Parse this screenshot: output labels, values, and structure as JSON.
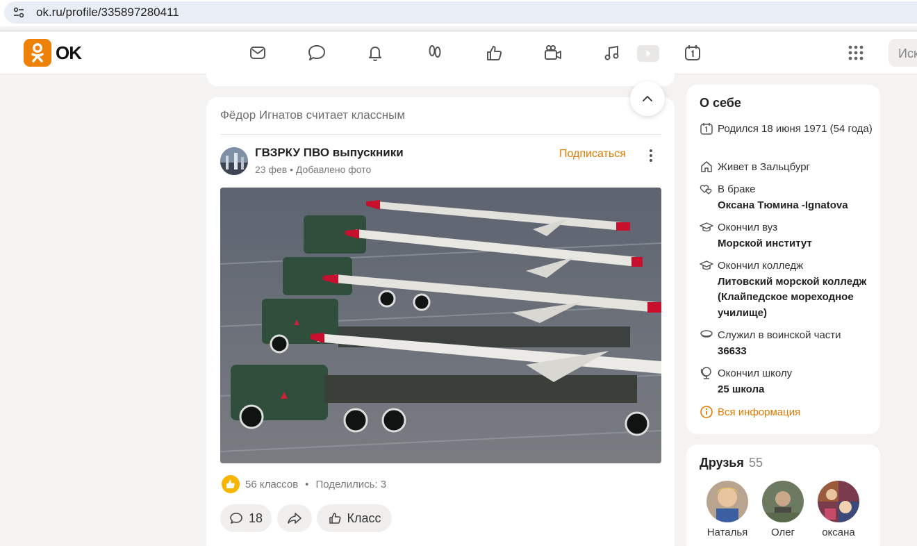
{
  "browser": {
    "url": "ok.ru/profile/335897280411"
  },
  "header": {
    "logo_text": "OK",
    "nav_icons": [
      "mail-icon",
      "chat-icon",
      "bell-icon",
      "guests-icon",
      "likes-icon",
      "video-icon",
      "music-icon",
      "play-icon",
      "calendar-icon"
    ],
    "search_placeholder": "Иск"
  },
  "feed": {
    "liked_by": "Фёдор Игнатов считает классным",
    "post": {
      "group_name": "ГВЗРКУ ПВО выпускники",
      "date": "23 фев",
      "meta_sep": "•",
      "action": "Добавлено фото",
      "subscribe_label": "Подписаться",
      "likes_text": "56 классов",
      "dot": "•",
      "shares_text": "Поделились: 3",
      "comments_count": "18",
      "class_label": "Класс"
    }
  },
  "about": {
    "title": "О себе",
    "rows": [
      {
        "icon": "birthday-icon",
        "text": "Родился 18 июня 1971 (54 года)",
        "bold": ""
      },
      {
        "icon": "home-icon",
        "text": "Живет в Зальцбург",
        "bold": ""
      },
      {
        "icon": "hearts-icon",
        "text": "В браке",
        "bold": "Оксана Тюмина -Ignatova"
      },
      {
        "icon": "graduation-cap-icon",
        "text": "Окончил вуз",
        "bold": "Морской институт"
      },
      {
        "icon": "graduation-cap-icon",
        "text": "Окончил колледж",
        "bold": "Литовский морской колледж (Клайпедское мореходное училище)"
      },
      {
        "icon": "military-cap-icon",
        "text": "Служил в воинской части",
        "bold": "36633"
      },
      {
        "icon": "globe-icon",
        "text": "Окончил школу",
        "bold": "25 школа"
      }
    ],
    "all_info_label": "Вся информация"
  },
  "friends": {
    "title": "Друзья",
    "count": "55",
    "list": [
      {
        "name": "Наталья"
      },
      {
        "name": "Олег"
      },
      {
        "name": "оксана"
      }
    ]
  },
  "colors": {
    "accent": "#ee8208",
    "link": "#e07a00",
    "like": "#f7b500",
    "page_bg": "#f4f3f1"
  }
}
